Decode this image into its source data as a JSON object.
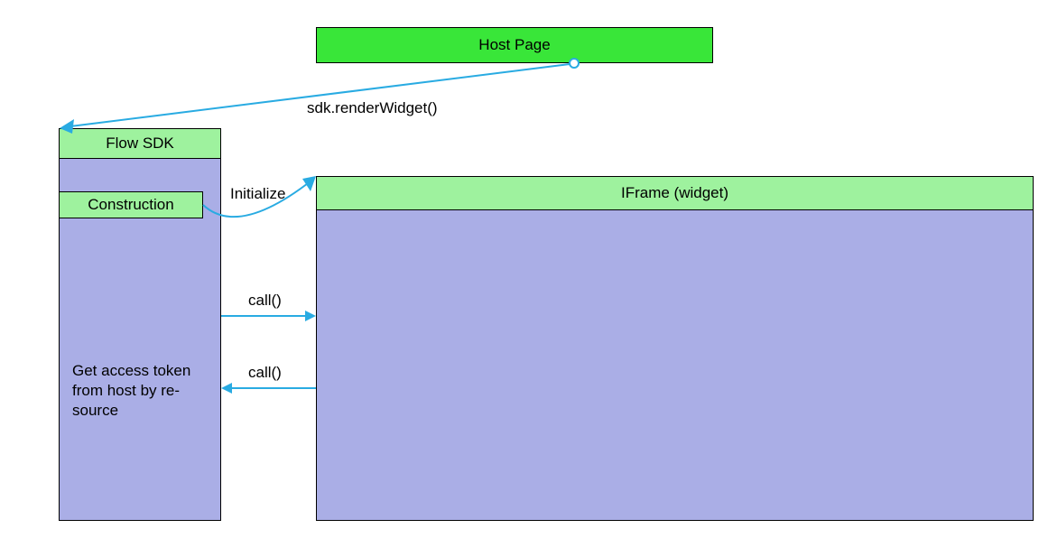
{
  "diagram": {
    "host_page": {
      "title": "Host Page"
    },
    "flow_sdk": {
      "title": "Flow SDK",
      "construction_label": "Construction",
      "access_token_text": "Get access token from host by re-source"
    },
    "iframe": {
      "title": "IFrame (widget)"
    },
    "arrows": {
      "render_widget_label": "sdk.renderWidget()",
      "initialize_label": "Initialize",
      "call_out_label": "call()",
      "call_back_label": "call()"
    },
    "colors": {
      "bright_green": "#39e639",
      "light_green": "#9ef29e",
      "lavender": "#aaaee6",
      "arrow_blue": "#29abe2"
    }
  }
}
